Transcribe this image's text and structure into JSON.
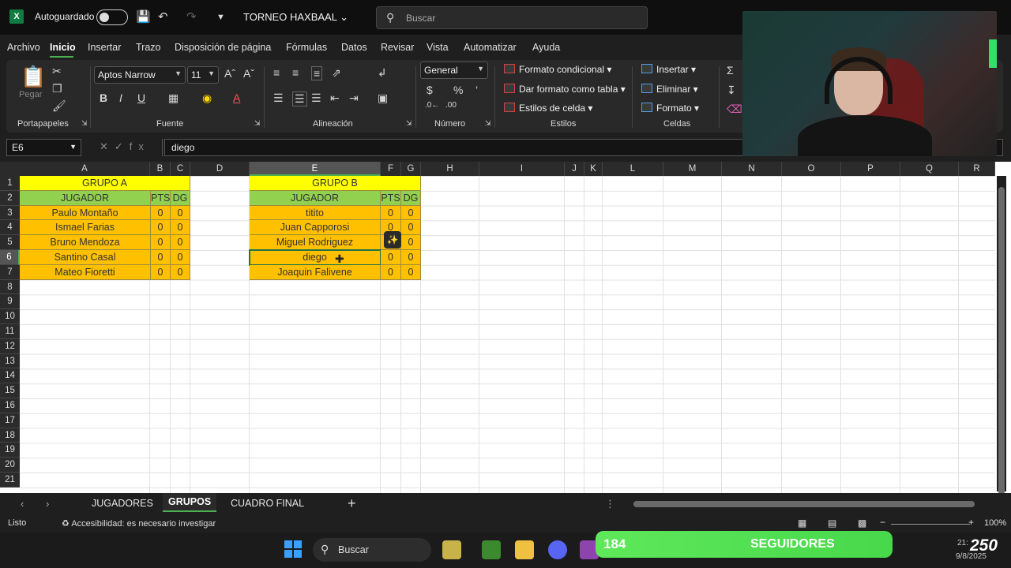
{
  "titlebar": {
    "app_letter": "X",
    "autosave_label": "Autoguardado",
    "doc_title": "TORNEO HAXBAAL",
    "search_placeholder": "Buscar"
  },
  "menu": [
    "Archivo",
    "Inicio",
    "Insertar",
    "Trazo",
    "Disposición de página",
    "Fórmulas",
    "Datos",
    "Revisar",
    "Vista",
    "Automatizar",
    "Ayuda"
  ],
  "ribbon": {
    "clipboard": {
      "paste_label": "Pegar",
      "group": "Portapapeles"
    },
    "font": {
      "name": "Aptos Narrow",
      "size": "11",
      "group": "Fuente"
    },
    "alignment": {
      "group": "Alineación"
    },
    "number": {
      "format": "General",
      "group": "Número"
    },
    "styles": {
      "cond_format": "Formato condicional",
      "table_format": "Dar formato como tabla",
      "cell_styles": "Estilos de celda",
      "group": "Estilos"
    },
    "cells": {
      "insert": "Insertar",
      "delete": "Eliminar",
      "format": "Formato",
      "group": "Celdas"
    }
  },
  "formulabar": {
    "namebox": "E6",
    "value": "diego"
  },
  "columns": [
    "A",
    "B",
    "C",
    "D",
    "E",
    "F",
    "G",
    "H",
    "I",
    "J",
    "K",
    "L",
    "M",
    "N",
    "O",
    "P",
    "Q",
    "R"
  ],
  "rows": [
    "1",
    "2",
    "3",
    "4",
    "5",
    "6",
    "7",
    "8",
    "9",
    "10",
    "11",
    "12",
    "13",
    "14",
    "15",
    "16",
    "17",
    "18",
    "19",
    "20",
    "21"
  ],
  "group_a": {
    "title": "GRUPO A",
    "headers": [
      "JUGADOR",
      "PTS",
      "DG"
    ],
    "rows": [
      [
        "Paulo Montaño",
        "0",
        "0"
      ],
      [
        "Ismael Farias",
        "0",
        "0"
      ],
      [
        "Bruno Mendoza",
        "0",
        "0"
      ],
      [
        "Santino Casal",
        "0",
        "0"
      ],
      [
        "Mateo Fioretti",
        "0",
        "0"
      ]
    ]
  },
  "group_b": {
    "title": "GRUPO B",
    "headers": [
      "JUGADOR",
      "PTS",
      "DG"
    ],
    "rows": [
      [
        "titito",
        "0",
        "0"
      ],
      [
        "Juan Capporosi",
        "0",
        "0"
      ],
      [
        "Miguel Rodriguez",
        "0",
        "0"
      ],
      [
        "diego",
        "0",
        "0"
      ],
      [
        "Joaquin Falivene",
        "0",
        "0"
      ]
    ]
  },
  "sheet_tabs": [
    "JUGADORES",
    "GRUPOS",
    "CUADRO FINAL"
  ],
  "active_sheet": "GRUPOS",
  "status": {
    "ready": "Listo",
    "accessibility": "Accesibilidad: es necesario investigar",
    "zoom": "100%"
  },
  "taskbar": {
    "search": "Buscar"
  },
  "overlay": {
    "followers": "184",
    "followers_label": "SEGUIDORES",
    "badge": "250",
    "time": "21:",
    "date": "9/8/2025"
  },
  "colors": {
    "yellow": "#ffff00",
    "green": "#92d050",
    "gold": "#ffc000",
    "accent": "#4caf50"
  }
}
